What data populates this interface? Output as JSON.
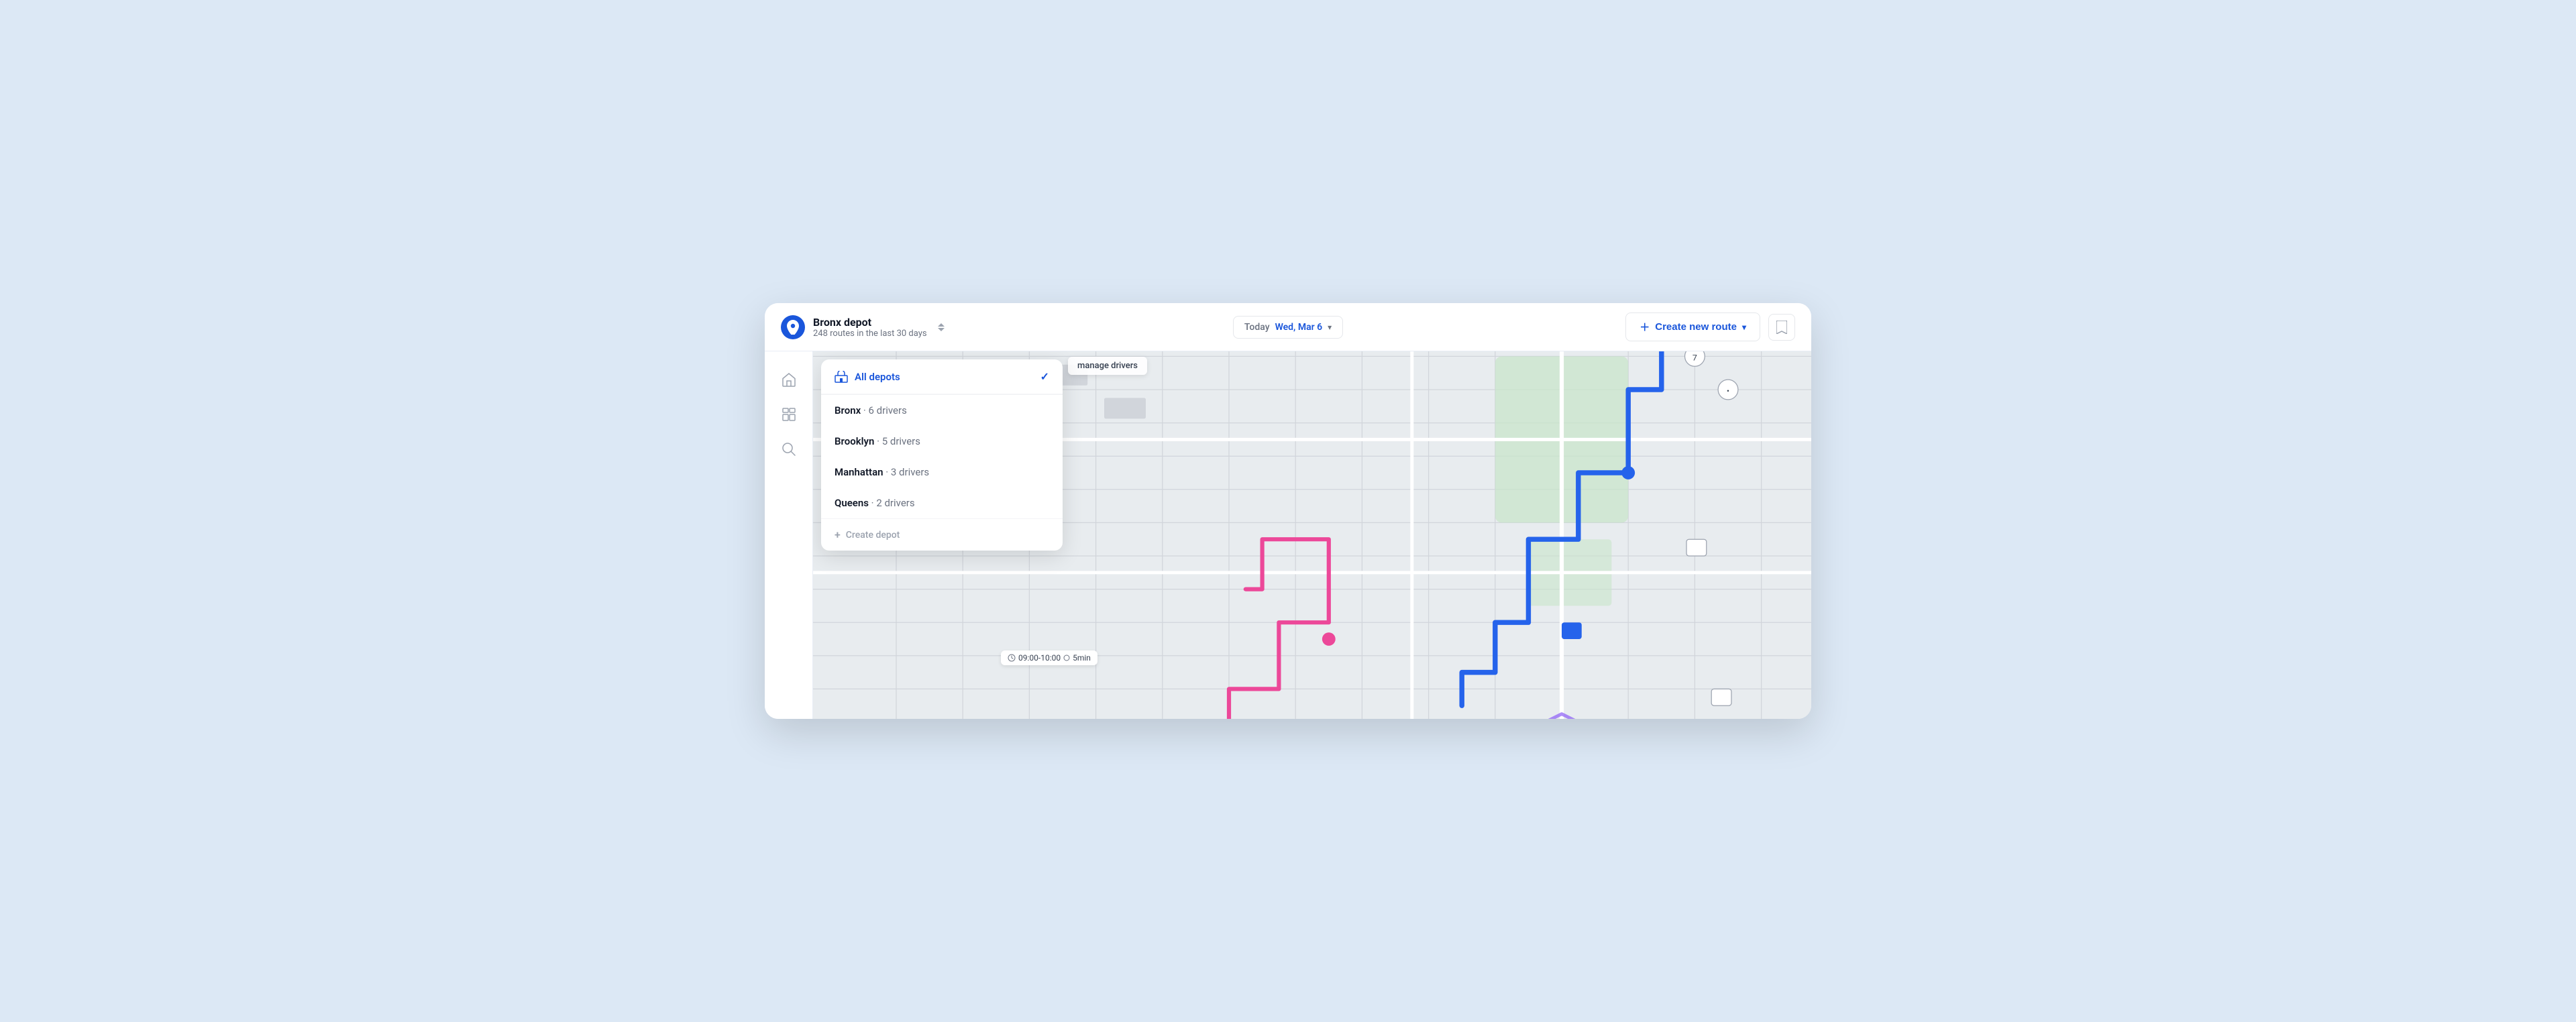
{
  "header": {
    "depot_name": "Bronx depot",
    "depot_stats": "248 routes in the last 30 days",
    "date_label": "Today",
    "date_value": "Wed, Mar 6",
    "create_route_label": "Create new route",
    "bookmark_label": "Bookmark"
  },
  "sidebar": {
    "items": [
      {
        "id": "home",
        "icon": "🏠",
        "label": "Home"
      },
      {
        "id": "dashboard",
        "icon": "📊",
        "label": "Dashboard"
      },
      {
        "id": "search",
        "icon": "🔍",
        "label": "Search"
      }
    ]
  },
  "depot_dropdown": {
    "all_depots_label": "All depots",
    "depots": [
      {
        "name": "Bronx",
        "drivers": 6
      },
      {
        "name": "Brooklyn",
        "drivers": 5
      },
      {
        "name": "Manhattan",
        "drivers": 3
      },
      {
        "name": "Queens",
        "drivers": 2
      }
    ],
    "create_depot_label": "Create depot",
    "drivers_suffix": "drivers"
  },
  "map": {
    "manage_drivers": "manage drivers",
    "time_badge": "09:00-10:00",
    "time_suffix": "5min"
  },
  "colors": {
    "blue_accent": "#1a56db",
    "route_blue": "#2563eb",
    "route_pink": "#ec4899"
  }
}
